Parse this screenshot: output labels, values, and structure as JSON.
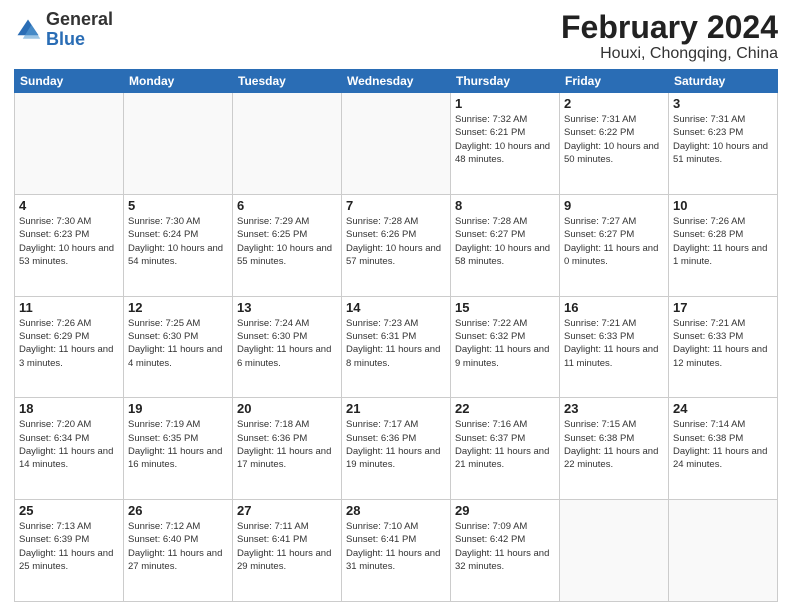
{
  "header": {
    "logo_general": "General",
    "logo_blue": "Blue",
    "title": "February 2024",
    "subtitle": "Houxi, Chongqing, China"
  },
  "days_of_week": [
    "Sunday",
    "Monday",
    "Tuesday",
    "Wednesday",
    "Thursday",
    "Friday",
    "Saturday"
  ],
  "weeks": [
    [
      {
        "day": "",
        "info": ""
      },
      {
        "day": "",
        "info": ""
      },
      {
        "day": "",
        "info": ""
      },
      {
        "day": "",
        "info": ""
      },
      {
        "day": "1",
        "info": "Sunrise: 7:32 AM\nSunset: 6:21 PM\nDaylight: 10 hours and 48 minutes."
      },
      {
        "day": "2",
        "info": "Sunrise: 7:31 AM\nSunset: 6:22 PM\nDaylight: 10 hours and 50 minutes."
      },
      {
        "day": "3",
        "info": "Sunrise: 7:31 AM\nSunset: 6:23 PM\nDaylight: 10 hours and 51 minutes."
      }
    ],
    [
      {
        "day": "4",
        "info": "Sunrise: 7:30 AM\nSunset: 6:23 PM\nDaylight: 10 hours and 53 minutes."
      },
      {
        "day": "5",
        "info": "Sunrise: 7:30 AM\nSunset: 6:24 PM\nDaylight: 10 hours and 54 minutes."
      },
      {
        "day": "6",
        "info": "Sunrise: 7:29 AM\nSunset: 6:25 PM\nDaylight: 10 hours and 55 minutes."
      },
      {
        "day": "7",
        "info": "Sunrise: 7:28 AM\nSunset: 6:26 PM\nDaylight: 10 hours and 57 minutes."
      },
      {
        "day": "8",
        "info": "Sunrise: 7:28 AM\nSunset: 6:27 PM\nDaylight: 10 hours and 58 minutes."
      },
      {
        "day": "9",
        "info": "Sunrise: 7:27 AM\nSunset: 6:27 PM\nDaylight: 11 hours and 0 minutes."
      },
      {
        "day": "10",
        "info": "Sunrise: 7:26 AM\nSunset: 6:28 PM\nDaylight: 11 hours and 1 minute."
      }
    ],
    [
      {
        "day": "11",
        "info": "Sunrise: 7:26 AM\nSunset: 6:29 PM\nDaylight: 11 hours and 3 minutes."
      },
      {
        "day": "12",
        "info": "Sunrise: 7:25 AM\nSunset: 6:30 PM\nDaylight: 11 hours and 4 minutes."
      },
      {
        "day": "13",
        "info": "Sunrise: 7:24 AM\nSunset: 6:30 PM\nDaylight: 11 hours and 6 minutes."
      },
      {
        "day": "14",
        "info": "Sunrise: 7:23 AM\nSunset: 6:31 PM\nDaylight: 11 hours and 8 minutes."
      },
      {
        "day": "15",
        "info": "Sunrise: 7:22 AM\nSunset: 6:32 PM\nDaylight: 11 hours and 9 minutes."
      },
      {
        "day": "16",
        "info": "Sunrise: 7:21 AM\nSunset: 6:33 PM\nDaylight: 11 hours and 11 minutes."
      },
      {
        "day": "17",
        "info": "Sunrise: 7:21 AM\nSunset: 6:33 PM\nDaylight: 11 hours and 12 minutes."
      }
    ],
    [
      {
        "day": "18",
        "info": "Sunrise: 7:20 AM\nSunset: 6:34 PM\nDaylight: 11 hours and 14 minutes."
      },
      {
        "day": "19",
        "info": "Sunrise: 7:19 AM\nSunset: 6:35 PM\nDaylight: 11 hours and 16 minutes."
      },
      {
        "day": "20",
        "info": "Sunrise: 7:18 AM\nSunset: 6:36 PM\nDaylight: 11 hours and 17 minutes."
      },
      {
        "day": "21",
        "info": "Sunrise: 7:17 AM\nSunset: 6:36 PM\nDaylight: 11 hours and 19 minutes."
      },
      {
        "day": "22",
        "info": "Sunrise: 7:16 AM\nSunset: 6:37 PM\nDaylight: 11 hours and 21 minutes."
      },
      {
        "day": "23",
        "info": "Sunrise: 7:15 AM\nSunset: 6:38 PM\nDaylight: 11 hours and 22 minutes."
      },
      {
        "day": "24",
        "info": "Sunrise: 7:14 AM\nSunset: 6:38 PM\nDaylight: 11 hours and 24 minutes."
      }
    ],
    [
      {
        "day": "25",
        "info": "Sunrise: 7:13 AM\nSunset: 6:39 PM\nDaylight: 11 hours and 25 minutes."
      },
      {
        "day": "26",
        "info": "Sunrise: 7:12 AM\nSunset: 6:40 PM\nDaylight: 11 hours and 27 minutes."
      },
      {
        "day": "27",
        "info": "Sunrise: 7:11 AM\nSunset: 6:41 PM\nDaylight: 11 hours and 29 minutes."
      },
      {
        "day": "28",
        "info": "Sunrise: 7:10 AM\nSunset: 6:41 PM\nDaylight: 11 hours and 31 minutes."
      },
      {
        "day": "29",
        "info": "Sunrise: 7:09 AM\nSunset: 6:42 PM\nDaylight: 11 hours and 32 minutes."
      },
      {
        "day": "",
        "info": ""
      },
      {
        "day": "",
        "info": ""
      }
    ]
  ]
}
